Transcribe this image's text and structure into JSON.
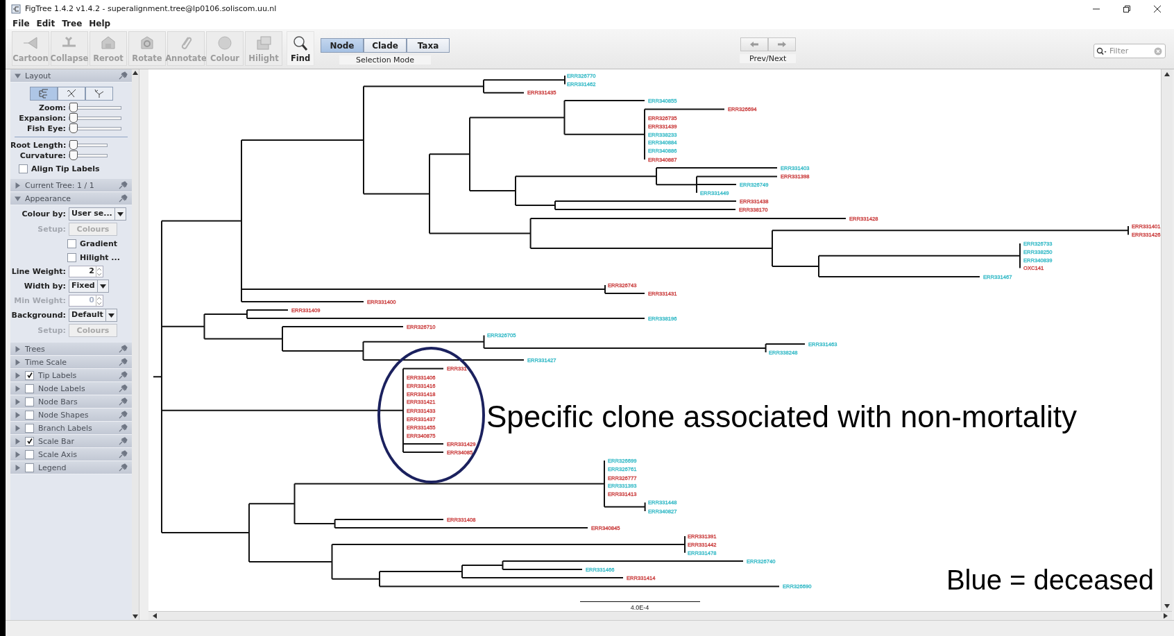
{
  "window": {
    "title": "FigTree 1.4.2 v1.4.2 - superalignment.tree@lp0106.soliscom.uu.nl"
  },
  "menu": [
    "File",
    "Edit",
    "Tree",
    "Help"
  ],
  "toolbar": {
    "tools": [
      {
        "label": "Cartoon",
        "disabled": true
      },
      {
        "label": "Collapse",
        "disabled": true
      },
      {
        "label": "Reroot",
        "disabled": true
      },
      {
        "label": "Rotate",
        "disabled": true
      },
      {
        "label": "Annotate",
        "disabled": true
      },
      {
        "label": "Colour",
        "disabled": true
      },
      {
        "label": "Hilight",
        "disabled": true
      },
      {
        "label": "Find",
        "disabled": false
      }
    ],
    "selection_mode": {
      "label": "Selection Mode",
      "options": [
        {
          "label": "Node",
          "selected": true
        },
        {
          "label": "Clade",
          "selected": false
        },
        {
          "label": "Taxa",
          "selected": false
        }
      ]
    },
    "prev_next": {
      "label": "Prev/Next"
    },
    "filter": {
      "placeholder": "Filter"
    }
  },
  "sidebar": [
    {
      "kind": "layout",
      "title": "Layout",
      "expanded": true,
      "modes": [
        {
          "selected": true
        },
        {
          "selected": false
        },
        {
          "selected": false
        }
      ],
      "sliders": [
        {
          "label": "Zoom:",
          "level": 0
        },
        {
          "label": "Expansion:",
          "level": 0
        },
        {
          "label": "Fish Eye:",
          "level": 0
        }
      ],
      "sliders_2": [
        {
          "label": "Root Length:",
          "level": 0
        },
        {
          "label": "Curvature:",
          "level": 0
        }
      ],
      "align": {
        "label": "Align Tip Labels",
        "checked": false
      }
    },
    {
      "kind": "header",
      "title": "Current Tree: 1 / 1",
      "expanded": false
    },
    {
      "kind": "appearance",
      "title": "Appearance",
      "expanded": true,
      "rows": [
        {
          "kind": "dropdown",
          "label": "Colour by:",
          "value": "User se..."
        },
        {
          "kind": "button",
          "label": "Setup:",
          "button": "Colours",
          "disabled": true
        },
        {
          "kind": "checkbox",
          "label": "Gradient",
          "checked": false
        },
        {
          "kind": "checkbox",
          "label": "Hilight ...",
          "checked": false
        },
        {
          "kind": "spinner",
          "label": "Line Weight:",
          "value": "2",
          "disabled": false
        },
        {
          "kind": "dropdown",
          "label": "Width by:",
          "value": "Fixed"
        },
        {
          "kind": "spinner",
          "label": "Min Weight:",
          "value": "0",
          "disabled": true
        },
        {
          "kind": "dropdown",
          "label": "Background:",
          "value": "Default"
        },
        {
          "kind": "button",
          "label": "Setup:",
          "button": "Colours",
          "disabled": true
        }
      ]
    },
    {
      "kind": "header",
      "title": "Trees",
      "expanded": false
    },
    {
      "kind": "header",
      "title": "Time Scale",
      "expanded": false
    },
    {
      "kind": "header",
      "title": "Tip Labels",
      "expanded": false,
      "checked": true
    },
    {
      "kind": "header",
      "title": "Node Labels",
      "expanded": false,
      "checked": false
    },
    {
      "kind": "header",
      "title": "Node Bars",
      "expanded": false,
      "checked": false
    },
    {
      "kind": "header",
      "title": "Node Shapes",
      "expanded": false,
      "checked": false
    },
    {
      "kind": "header",
      "title": "Branch Labels",
      "expanded": false,
      "checked": false
    },
    {
      "kind": "header",
      "title": "Scale Bar",
      "expanded": false,
      "checked": true
    },
    {
      "kind": "header",
      "title": "Scale Axis",
      "expanded": false,
      "checked": false
    },
    {
      "kind": "header",
      "title": "Legend",
      "expanded": false,
      "checked": false
    }
  ],
  "tree": {
    "tips": [
      {
        "label": "ERR326770",
        "color": "#33b9c6"
      },
      {
        "label": "ERR331462",
        "color": "#33b9c6"
      },
      {
        "label": "ERR331435",
        "color": "#c93a3a"
      },
      {
        "label": "ERR340855",
        "color": "#33b9c6"
      },
      {
        "label": "ERR326694",
        "color": "#c93a3a"
      },
      {
        "label": "ERR326735",
        "color": "#c93a3a"
      },
      {
        "label": "ERR331439",
        "color": "#c93a3a"
      },
      {
        "label": "ERR338233",
        "color": "#33b9c6"
      },
      {
        "label": "ERR340884",
        "color": "#33b9c6"
      },
      {
        "label": "ERR340886",
        "color": "#33b9c6"
      },
      {
        "label": "ERR340887",
        "color": "#c93a3a"
      },
      {
        "label": "ERR331403",
        "color": "#33b9c6"
      },
      {
        "label": "ERR331398",
        "color": "#c93a3a"
      },
      {
        "label": "ERR326749",
        "color": "#33b9c6"
      },
      {
        "label": "ERR331449",
        "color": "#33b9c6"
      },
      {
        "label": "ERR331438",
        "color": "#c93a3a"
      },
      {
        "label": "ERR338170",
        "color": "#c93a3a"
      },
      {
        "label": "ERR331428",
        "color": "#c93a3a"
      },
      {
        "label": "ERR331401",
        "color": "#c93a3a"
      },
      {
        "label": "ERR331426",
        "color": "#c93a3a"
      },
      {
        "label": "ERR326733",
        "color": "#33b9c6"
      },
      {
        "label": "ERR338250",
        "color": "#33b9c6"
      },
      {
        "label": "ERR340839",
        "color": "#33b9c6"
      },
      {
        "label": "OXC141",
        "color": "#c93a3a"
      },
      {
        "label": "ERR331467",
        "color": "#33b9c6"
      },
      {
        "label": "ERR326743",
        "color": "#c93a3a"
      },
      {
        "label": "ERR331431",
        "color": "#c93a3a"
      },
      {
        "label": "ERR331400",
        "color": "#c93a3a"
      },
      {
        "label": "ERR331409",
        "color": "#c93a3a"
      },
      {
        "label": "ERR338196",
        "color": "#33b9c6"
      },
      {
        "label": "ERR326710",
        "color": "#c93a3a"
      },
      {
        "label": "ERR326705",
        "color": "#33b9c6"
      },
      {
        "label": "ERR331463",
        "color": "#33b9c6"
      },
      {
        "label": "ERR338248",
        "color": "#33b9c6"
      },
      {
        "label": "ERR331427",
        "color": "#33b9c6"
      },
      {
        "label": "ERR331",
        "color": "#c93a3a"
      },
      {
        "label": "ERR331406",
        "color": "#c93a3a"
      },
      {
        "label": "ERR331416",
        "color": "#c93a3a"
      },
      {
        "label": "ERR331418",
        "color": "#c93a3a"
      },
      {
        "label": "ERR331421",
        "color": "#c93a3a"
      },
      {
        "label": "ERR331433",
        "color": "#c93a3a"
      },
      {
        "label": "ERR331437",
        "color": "#c93a3a"
      },
      {
        "label": "ERR331455",
        "color": "#c93a3a"
      },
      {
        "label": "ERR340875",
        "color": "#c93a3a"
      },
      {
        "label": "ERR331429",
        "color": "#c93a3a"
      },
      {
        "label": "ERR34085",
        "color": "#c93a3a"
      },
      {
        "label": "ERR326699",
        "color": "#33b9c6"
      },
      {
        "label": "ERR326761",
        "color": "#33b9c6"
      },
      {
        "label": "ERR326777",
        "color": "#c93a3a"
      },
      {
        "label": "ERR331393",
        "color": "#33b9c6"
      },
      {
        "label": "ERR331413",
        "color": "#c93a3a"
      },
      {
        "label": "ERR331448",
        "color": "#33b9c6"
      },
      {
        "label": "ERR340827",
        "color": "#33b9c6"
      },
      {
        "label": "ERR331408",
        "color": "#c93a3a"
      },
      {
        "label": "ERR340845",
        "color": "#c93a3a"
      },
      {
        "label": "ERR331391",
        "color": "#c93a3a"
      },
      {
        "label": "ERR331442",
        "color": "#c93a3a"
      },
      {
        "label": "ERR331478",
        "color": "#33b9c6"
      },
      {
        "label": "ERR326740",
        "color": "#33b9c6"
      },
      {
        "label": "ERR331466",
        "color": "#33b9c6"
      },
      {
        "label": "ERR331414",
        "color": "#c93a3a"
      },
      {
        "label": "ERR326690",
        "color": "#33b9c6"
      }
    ],
    "scale_bar": {
      "label": "4.0E-4"
    },
    "annotations": [
      {
        "text": "Specific clone associated with non-mortality"
      },
      {
        "text": "Blue = deceased"
      }
    ]
  }
}
